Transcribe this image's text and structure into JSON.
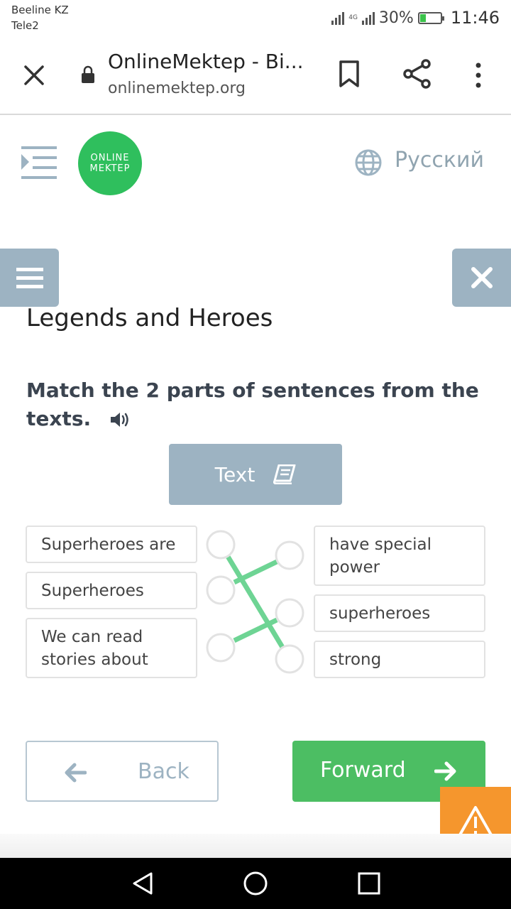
{
  "status_bar": {
    "carrier_1": "Beeline KZ",
    "carrier_2": "Tele2",
    "network_label": "4G",
    "battery_percent": "30%",
    "battery_level": 0.3,
    "time": "11:46"
  },
  "browser": {
    "title": "OnlineMektep - Bi...",
    "url": "onlinemektep.org"
  },
  "site": {
    "logo_line_1": "ONLINE",
    "logo_line_2": "MEKTEP",
    "language": "Русский",
    "brand_color": "#2fbf5d"
  },
  "lesson": {
    "title": "Legends and Heroes",
    "instruction": "Match the 2 parts of sentences from the texts.",
    "text_button": "Text"
  },
  "matching": {
    "left": [
      "Superheroes are",
      "Superheroes",
      "We can read stories about"
    ],
    "right": [
      "have special power",
      "superheroes",
      "strong"
    ],
    "connections": [
      {
        "from": "Superheroes are",
        "to": "strong"
      },
      {
        "from": "Superheroes",
        "to": "have special power"
      },
      {
        "from": "We can read stories about",
        "to": "superheroes"
      }
    ],
    "line_color": "#6ed494"
  },
  "navigation": {
    "back_label": "Back",
    "forward_label": "Forward",
    "forward_color": "#4cbe63",
    "warning_color": "#f5962d"
  }
}
